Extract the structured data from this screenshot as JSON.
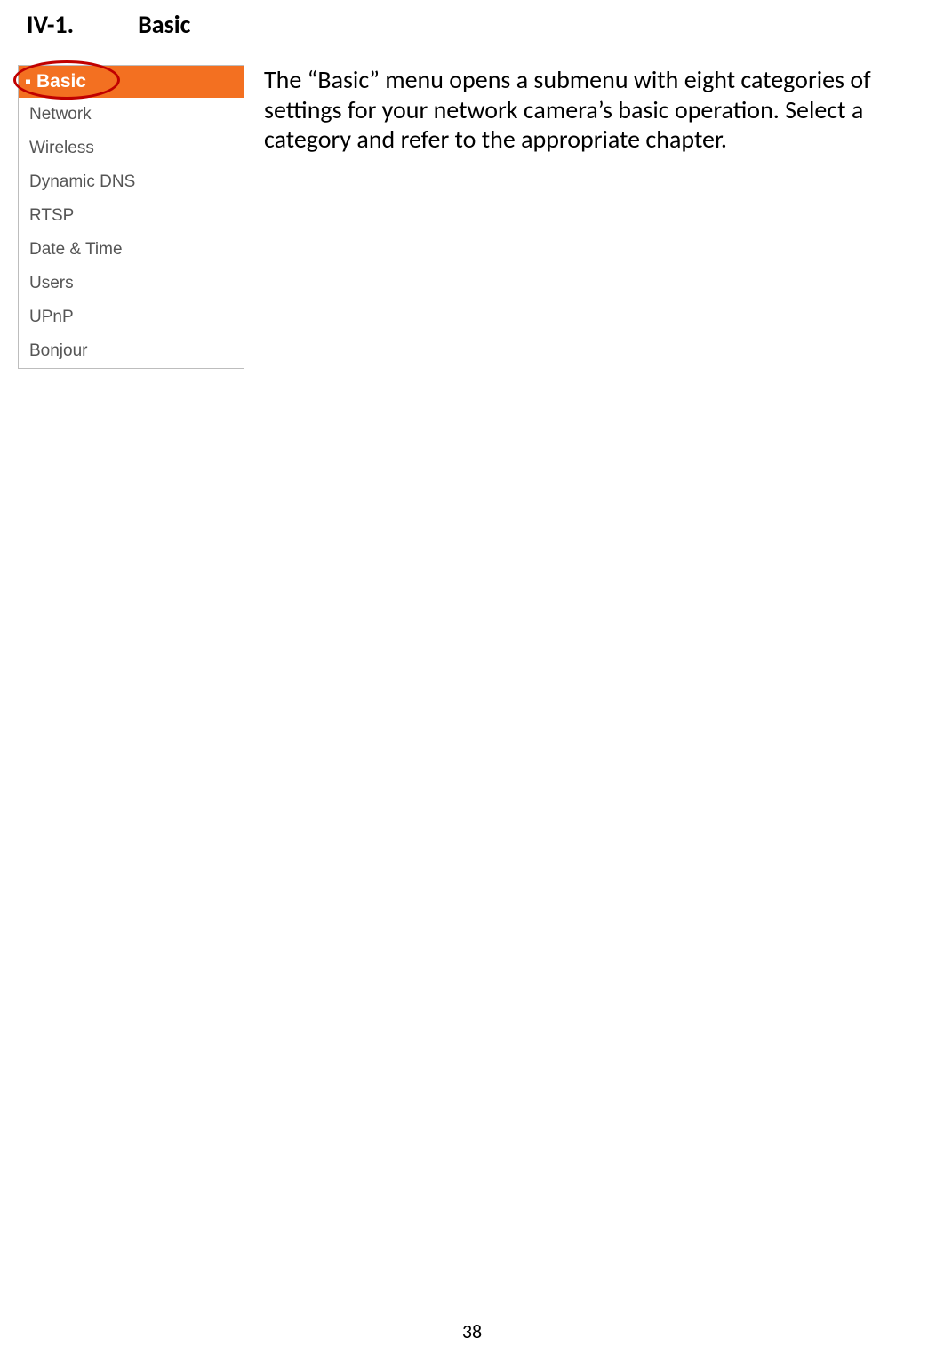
{
  "heading": {
    "number": "IV-1.",
    "title": "Basic"
  },
  "menu": {
    "header": "Basic",
    "items": [
      "Network",
      "Wireless",
      "Dynamic DNS",
      "RTSP",
      "Date & Time",
      "Users",
      "UPnP",
      "Bonjour"
    ]
  },
  "description": "The “Basic” menu opens a submenu with eight categories of settings for your network camera’s basic operation. Select a category and refer to the appropriate chapter.",
  "page_number": "38"
}
